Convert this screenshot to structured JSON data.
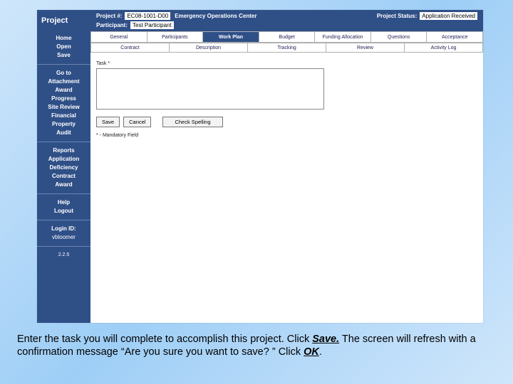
{
  "header": {
    "brand": "Project",
    "project_num_label": "Project #:",
    "project_num_value": "EC08-1001-D00",
    "project_name": "Emergency Operations Center",
    "status_label": "Project Status:",
    "status_value": "Application Received",
    "participant_label": "Participant:",
    "participant_value": "Test Participant"
  },
  "sidebar": {
    "group1": [
      "Home",
      "Open",
      "Save"
    ],
    "group2": [
      "Go to",
      "Attachment",
      "Award",
      "Progress",
      "Site Review",
      "Financial",
      "Property",
      "Audit"
    ],
    "group3": [
      "Reports",
      "Application",
      "Deficiency",
      "Contract",
      "Award"
    ],
    "group4": [
      "Help",
      "Logout"
    ],
    "login_label": "Login ID:",
    "login_value": "vbloomer",
    "version": "2.2.5"
  },
  "tabs_primary": [
    "General",
    "Participants",
    "Work Plan",
    "Budget",
    "Funding Allocation",
    "Questions",
    "Acceptance"
  ],
  "tabs_primary_active": 2,
  "tabs_secondary": [
    "Contract",
    "Description",
    "Tracking",
    "Review",
    "Activity Log"
  ],
  "form": {
    "task_label": "Task *",
    "task_value": "",
    "save_btn": "Save",
    "cancel_btn": "Cancel",
    "check_spelling_btn": "Check Spelling",
    "mandatory_note": "* - Mandatory Field"
  },
  "instructions": {
    "pre": "Enter the task you will complete to accomplish this project.  Click ",
    "save": "Save.",
    "mid": "  The screen will refresh with a confirmation message “Are you sure you want to save? ” Click ",
    "ok": "OK",
    "post": "."
  }
}
